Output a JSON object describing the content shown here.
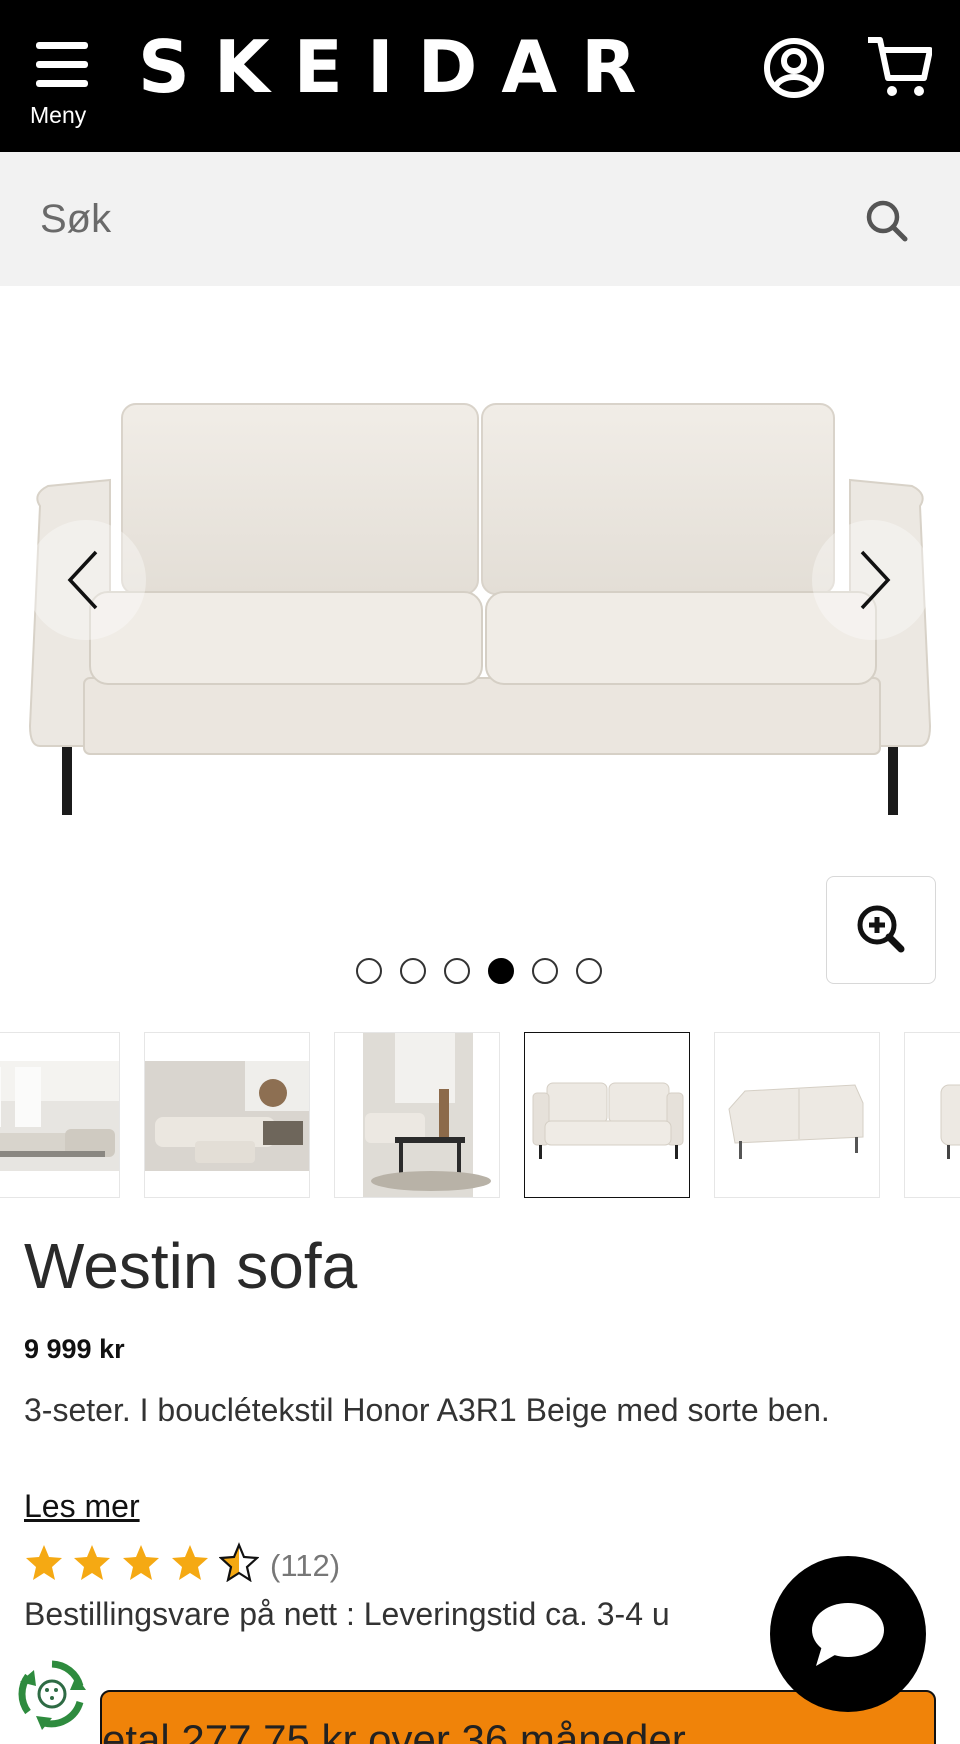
{
  "header": {
    "menu_label": "Meny",
    "logo_text": "SKEIDAR",
    "background_color": "#000000",
    "account_icon": "user-circle-icon",
    "cart_icon": "shopping-cart-icon"
  },
  "search": {
    "placeholder": "Søk",
    "icon": "search-icon"
  },
  "gallery": {
    "prev_icon": "chevron-left-icon",
    "next_icon": "chevron-right-icon",
    "zoom_icon": "zoom-in-icon",
    "dot_count": 6,
    "active_dot": 4,
    "selected_thumbnail": 4
  },
  "product": {
    "name": "Westin sofa",
    "price": "9 999 kr",
    "description": "3-seter. I bouclétekstil Honor A3R1 Beige med sorte ben.",
    "read_more": "Les mer",
    "rating": 4.5,
    "rating_max": 5,
    "review_count": "(112)",
    "star_color": "#f5a913",
    "delivery": "Bestillingsvare på nett : Leveringstid ca. 3-4 u"
  },
  "financing": {
    "label": "etal 277,75 kr over 36 måneder",
    "color": "#f08309"
  },
  "chat": {
    "icon": "chat-bubble-icon"
  },
  "eco_badge": {
    "icon": "recycle-badge-icon"
  }
}
